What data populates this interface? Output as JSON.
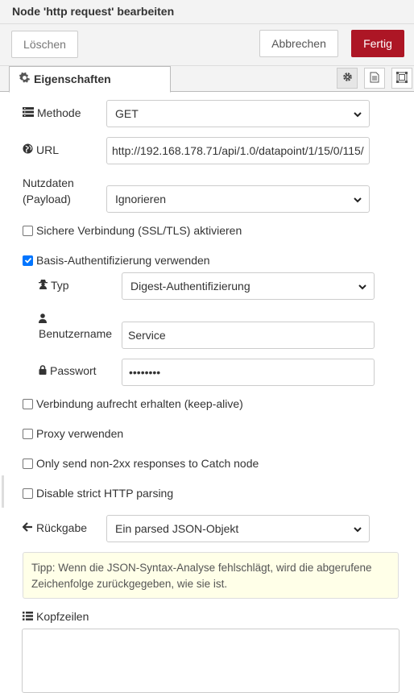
{
  "header": {
    "title": "Node 'http request' bearbeiten"
  },
  "toolbar": {
    "delete_label": "Löschen",
    "cancel_label": "Abbrechen",
    "done_label": "Fertig"
  },
  "tabs": {
    "properties_label": "Eigenschaften"
  },
  "colors": {
    "done_button": "#ad1625",
    "tip_background": "#ffffe8",
    "checkbox_checked": "#0075ff"
  },
  "form": {
    "method": {
      "label": "Methode",
      "value": "GET"
    },
    "url": {
      "label": "URL",
      "value": "http://192.168.178.71/api/1.0/datapoint/1/15/0/115/"
    },
    "payload": {
      "label_line1": "Nutzdaten",
      "label_line2": "(Payload)",
      "value": "Ignorieren"
    },
    "ssl": {
      "label": "Sichere Verbindung (SSL/TLS) aktivieren",
      "checked": false
    },
    "basic_auth": {
      "label": "Basis-Authentifizierung verwenden",
      "checked": true
    },
    "auth_type": {
      "label": "Typ",
      "value": "Digest-Authentifizierung"
    },
    "username": {
      "label": "Benutzername",
      "value": "Service"
    },
    "password": {
      "label": "Passwort",
      "value": "••••••••"
    },
    "keepalive": {
      "label": "Verbindung aufrecht erhalten (keep-alive)",
      "checked": false
    },
    "proxy": {
      "label": "Proxy verwenden",
      "checked": false
    },
    "non2xx": {
      "label": "Only send non-2xx responses to Catch node",
      "checked": false
    },
    "strict_http": {
      "label": "Disable strict HTTP parsing",
      "checked": false
    },
    "return": {
      "label": "Rückgabe",
      "value": "Ein parsed JSON-Objekt"
    },
    "tip": "Tipp: Wenn die JSON-Syntax-Analyse fehlschlägt, wird die abgerufene Zeichenfolge zurückgegeben, wie sie ist.",
    "headers": {
      "label": "Kopfzeilen"
    }
  }
}
